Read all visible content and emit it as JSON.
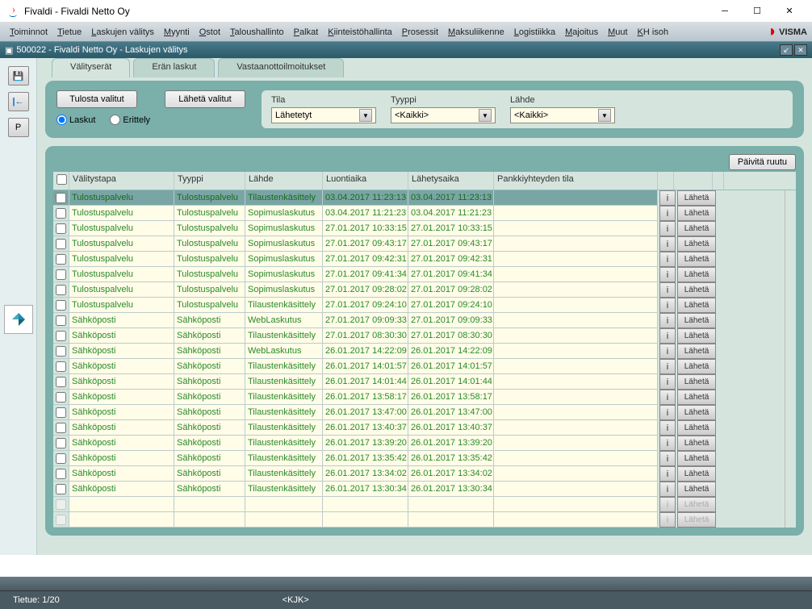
{
  "window": {
    "title": "Fivaldi - Fivaldi Netto Oy"
  },
  "menubar": {
    "items": [
      {
        "label": "Toiminnot",
        "u": "T"
      },
      {
        "label": "Tietue",
        "u": "T"
      },
      {
        "label": "Laskujen välitys",
        "u": "L"
      },
      {
        "label": "Myynti",
        "u": "M"
      },
      {
        "label": "Ostot",
        "u": "O"
      },
      {
        "label": "Taloushallinto",
        "u": "T"
      },
      {
        "label": "Palkat",
        "u": "P"
      },
      {
        "label": "Kiinteistöhallinta",
        "u": "K"
      },
      {
        "label": "Prosessit",
        "u": "P"
      },
      {
        "label": "Maksuliikenne",
        "u": "M"
      },
      {
        "label": "Logistiikka",
        "u": "L"
      },
      {
        "label": "Majoitus",
        "u": "M"
      },
      {
        "label": "Muut",
        "u": "M"
      },
      {
        "label": "KH isoh",
        "u": "K"
      }
    ],
    "logo": "VISMA"
  },
  "subwindow": {
    "title": "500022 - Fivaldi Netto Oy - Laskujen välitys"
  },
  "left_toolbar": {
    "save": "💾",
    "back": "⟵",
    "p": "P"
  },
  "tabs": {
    "items": [
      {
        "label": "Välityserät",
        "active": true
      },
      {
        "label": "Erän laskut",
        "active": false
      },
      {
        "label": "Vastaanottoilmoitukset",
        "active": false
      }
    ]
  },
  "filter": {
    "print_btn": "Tulosta valitut",
    "send_btn": "Lähetä valitut",
    "radio_laskut": "Laskut",
    "radio_erittely": "Erittely",
    "tila_label": "Tila",
    "tila_value": "Lähetetyt",
    "tyyppi_label": "Tyyppi",
    "tyyppi_value": "<Kaikki>",
    "lahde_label": "Lähde",
    "lahde_value": "<Kaikki>"
  },
  "grid": {
    "refresh_btn": "Päivitä ruutu",
    "headers": {
      "valitystapa": "Välitystapa",
      "tyyppi": "Tyyppi",
      "lahde": "Lähde",
      "luontiaika": "Luontiaika",
      "lahetysaika": "Lähetysaika",
      "pankki": "Pankkiyhteyden tila"
    },
    "info_btn": "i",
    "send_btn": "Lähetä",
    "rows": [
      {
        "valitystapa": "Tulostuspalvelu",
        "tyyppi": "Tulostuspalvelu",
        "lahde": "Tilaustenkäsittely",
        "luonti": "03.04.2017 11:23:13",
        "lahetys": "03.04.2017 11:23:13",
        "pankki": ""
      },
      {
        "valitystapa": "Tulostuspalvelu",
        "tyyppi": "Tulostuspalvelu",
        "lahde": "Sopimuslaskutus",
        "luonti": "03.04.2017 11:21:23",
        "lahetys": "03.04.2017 11:21:23",
        "pankki": ""
      },
      {
        "valitystapa": "Tulostuspalvelu",
        "tyyppi": "Tulostuspalvelu",
        "lahde": "Sopimuslaskutus",
        "luonti": "27.01.2017 10:33:15",
        "lahetys": "27.01.2017 10:33:15",
        "pankki": ""
      },
      {
        "valitystapa": "Tulostuspalvelu",
        "tyyppi": "Tulostuspalvelu",
        "lahde": "Sopimuslaskutus",
        "luonti": "27.01.2017 09:43:17",
        "lahetys": "27.01.2017 09:43:17",
        "pankki": ""
      },
      {
        "valitystapa": "Tulostuspalvelu",
        "tyyppi": "Tulostuspalvelu",
        "lahde": "Sopimuslaskutus",
        "luonti": "27.01.2017 09:42:31",
        "lahetys": "27.01.2017 09:42:31",
        "pankki": ""
      },
      {
        "valitystapa": "Tulostuspalvelu",
        "tyyppi": "Tulostuspalvelu",
        "lahde": "Sopimuslaskutus",
        "luonti": "27.01.2017 09:41:34",
        "lahetys": "27.01.2017 09:41:34",
        "pankki": ""
      },
      {
        "valitystapa": "Tulostuspalvelu",
        "tyyppi": "Tulostuspalvelu",
        "lahde": "Sopimuslaskutus",
        "luonti": "27.01.2017 09:28:02",
        "lahetys": "27.01.2017 09:28:02",
        "pankki": ""
      },
      {
        "valitystapa": "Tulostuspalvelu",
        "tyyppi": "Tulostuspalvelu",
        "lahde": "Tilaustenkäsittely",
        "luonti": "27.01.2017 09:24:10",
        "lahetys": "27.01.2017 09:24:10",
        "pankki": ""
      },
      {
        "valitystapa": "Sähköposti",
        "tyyppi": "Sähköposti",
        "lahde": "WebLaskutus",
        "luonti": "27.01.2017 09:09:33",
        "lahetys": "27.01.2017 09:09:33",
        "pankki": ""
      },
      {
        "valitystapa": "Sähköposti",
        "tyyppi": "Sähköposti",
        "lahde": "Tilaustenkäsittely",
        "luonti": "27.01.2017 08:30:30",
        "lahetys": "27.01.2017 08:30:30",
        "pankki": ""
      },
      {
        "valitystapa": "Sähköposti",
        "tyyppi": "Sähköposti",
        "lahde": "WebLaskutus",
        "luonti": "26.01.2017 14:22:09",
        "lahetys": "26.01.2017 14:22:09",
        "pankki": ""
      },
      {
        "valitystapa": "Sähköposti",
        "tyyppi": "Sähköposti",
        "lahde": "Tilaustenkäsittely",
        "luonti": "26.01.2017 14:01:57",
        "lahetys": "26.01.2017 14:01:57",
        "pankki": ""
      },
      {
        "valitystapa": "Sähköposti",
        "tyyppi": "Sähköposti",
        "lahde": "Tilaustenkäsittely",
        "luonti": "26.01.2017 14:01:44",
        "lahetys": "26.01.2017 14:01:44",
        "pankki": ""
      },
      {
        "valitystapa": "Sähköposti",
        "tyyppi": "Sähköposti",
        "lahde": "Tilaustenkäsittely",
        "luonti": "26.01.2017 13:58:17",
        "lahetys": "26.01.2017 13:58:17",
        "pankki": ""
      },
      {
        "valitystapa": "Sähköposti",
        "tyyppi": "Sähköposti",
        "lahde": "Tilaustenkäsittely",
        "luonti": "26.01.2017 13:47:00",
        "lahetys": "26.01.2017 13:47:00",
        "pankki": ""
      },
      {
        "valitystapa": "Sähköposti",
        "tyyppi": "Sähköposti",
        "lahde": "Tilaustenkäsittely",
        "luonti": "26.01.2017 13:40:37",
        "lahetys": "26.01.2017 13:40:37",
        "pankki": ""
      },
      {
        "valitystapa": "Sähköposti",
        "tyyppi": "Sähköposti",
        "lahde": "Tilaustenkäsittely",
        "luonti": "26.01.2017 13:39:20",
        "lahetys": "26.01.2017 13:39:20",
        "pankki": ""
      },
      {
        "valitystapa": "Sähköposti",
        "tyyppi": "Sähköposti",
        "lahde": "Tilaustenkäsittely",
        "luonti": "26.01.2017 13:35:42",
        "lahetys": "26.01.2017 13:35:42",
        "pankki": ""
      },
      {
        "valitystapa": "Sähköposti",
        "tyyppi": "Sähköposti",
        "lahde": "Tilaustenkäsittely",
        "luonti": "26.01.2017 13:34:02",
        "lahetys": "26.01.2017 13:34:02",
        "pankki": ""
      },
      {
        "valitystapa": "Sähköposti",
        "tyyppi": "Sähköposti",
        "lahde": "Tilaustenkäsittely",
        "luonti": "26.01.2017 13:30:34",
        "lahetys": "26.01.2017 13:30:34",
        "pankki": ""
      }
    ],
    "empty_rows": 2
  },
  "statusbar": {
    "record": "Tietue: 1/20",
    "user": "<KJK>"
  }
}
